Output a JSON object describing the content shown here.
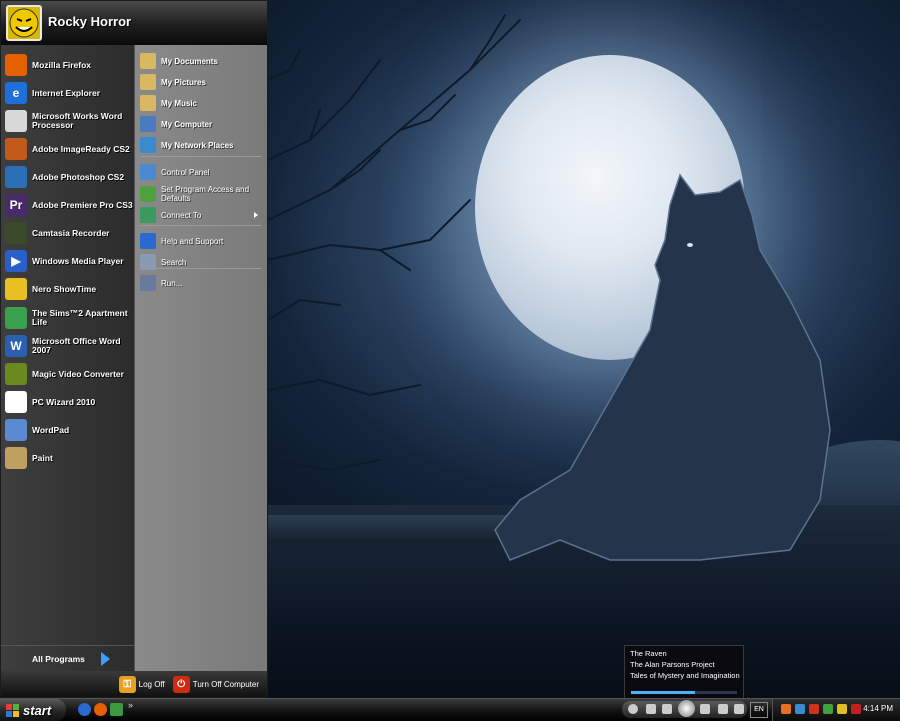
{
  "user": {
    "name": "Rocky Horror"
  },
  "programs": [
    {
      "label": "Mozilla Firefox",
      "icon": "firefox-icon",
      "color": "#e66000",
      "glyph": ""
    },
    {
      "label": "Internet Explorer",
      "icon": "internet-explorer-icon",
      "color": "#1e6fd9",
      "glyph": "e"
    },
    {
      "label": "Microsoft Works Word Processor",
      "icon": "works-word-processor-icon",
      "color": "#d8d8d8",
      "glyph": ""
    },
    {
      "label": "Adobe ImageReady CS2",
      "icon": "imageready-icon",
      "color": "#c25a1c",
      "glyph": ""
    },
    {
      "label": "Adobe Photoshop CS2",
      "icon": "photoshop-icon",
      "color": "#2a6fb8",
      "glyph": ""
    },
    {
      "label": "Adobe Premiere Pro CS3",
      "icon": "premiere-icon",
      "color": "#4a2a6a",
      "glyph": "Pr"
    },
    {
      "label": "Camtasia Recorder",
      "icon": "camtasia-icon",
      "color": "#3a4a2a",
      "glyph": ""
    },
    {
      "label": "Windows Media Player",
      "icon": "media-player-icon",
      "color": "#2a5fc8",
      "glyph": "▶"
    },
    {
      "label": "Nero ShowTime",
      "icon": "nero-icon",
      "color": "#e8c020",
      "glyph": ""
    },
    {
      "label": "The Sims™2 Apartment Life",
      "icon": "sims-icon",
      "color": "#3aa050",
      "glyph": ""
    },
    {
      "label": "Microsoft Office Word 2007",
      "icon": "word-icon",
      "color": "#2b5fb0",
      "glyph": "W"
    },
    {
      "label": "Magic Video Converter",
      "icon": "video-converter-icon",
      "color": "#6a8a20",
      "glyph": ""
    },
    {
      "label": "PC Wizard 2010",
      "icon": "pc-wizard-icon",
      "color": "#ffffff",
      "glyph": ""
    },
    {
      "label": "WordPad",
      "icon": "wordpad-icon",
      "color": "#5a8ad0",
      "glyph": ""
    },
    {
      "label": "Paint",
      "icon": "paint-icon",
      "color": "#c0a060",
      "glyph": ""
    }
  ],
  "all_programs_label": "All Programs",
  "places": [
    {
      "label": "My Documents",
      "icon": "documents-folder-icon",
      "bold": true,
      "color": "#d8b860"
    },
    {
      "label": "My Pictures",
      "icon": "pictures-folder-icon",
      "bold": true,
      "color": "#d8b860"
    },
    {
      "label": "My Music",
      "icon": "music-folder-icon",
      "bold": true,
      "color": "#d8b860"
    },
    {
      "label": "My Computer",
      "icon": "computer-icon",
      "bold": true,
      "color": "#4a7ac0"
    },
    {
      "label": "My Network Places",
      "icon": "network-icon",
      "bold": true,
      "color": "#3a8ad0"
    },
    {
      "label": "Control Panel",
      "icon": "control-panel-icon",
      "bold": false,
      "color": "#4a8ad0"
    },
    {
      "label": "Set Program Access and Defaults",
      "icon": "program-defaults-icon",
      "bold": false,
      "color": "#50a040"
    },
    {
      "label": "Connect To",
      "icon": "connect-icon",
      "bold": false,
      "color": "#3a9a60",
      "submenu": true
    },
    {
      "label": "Help and Support",
      "icon": "help-icon",
      "bold": false,
      "color": "#2a6ad0"
    },
    {
      "label": "Search",
      "icon": "search-icon",
      "bold": false,
      "color": "#8a9ab0"
    },
    {
      "label": "Run...",
      "icon": "run-icon",
      "bold": false,
      "color": "#6a7a9a"
    }
  ],
  "footer": {
    "log_off": "Log Off",
    "turn_off": "Turn Off Computer"
  },
  "media": {
    "title": "The Raven",
    "artist": "The Alan Parsons Project",
    "album": "Tales of Mystery and Imagination",
    "progress": 0.6
  },
  "taskbar": {
    "start_label": "start",
    "language": "EN",
    "clock": "4:14 PM"
  }
}
